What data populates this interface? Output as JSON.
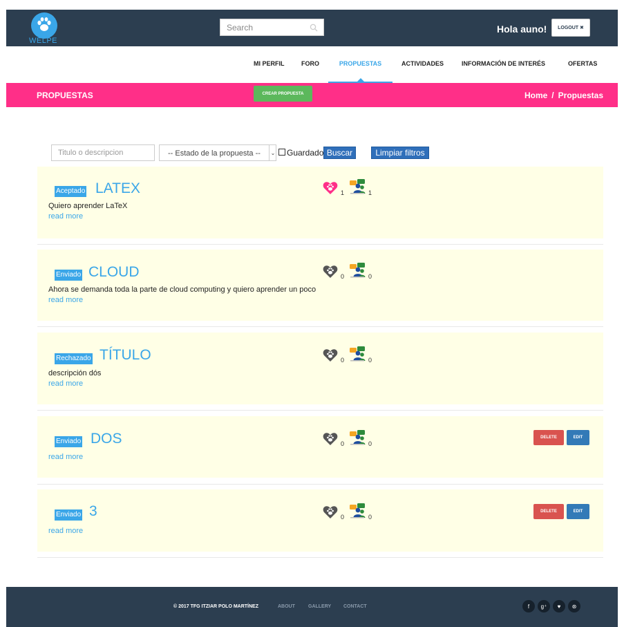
{
  "header": {
    "logo_text": "WELPE",
    "search_placeholder": "Search",
    "greeting": "Hola auno!",
    "logout_label": "LOGOUT ✖"
  },
  "nav": {
    "items": [
      "MI PERFIL",
      "FORO",
      "PROPUESTAS",
      "ACTIVIDADES",
      "INFORMACIÓN DE INTERÉS",
      "OFERTAS"
    ],
    "active": "PROPUESTAS"
  },
  "section": {
    "title": "PROPUESTAS",
    "create_label": "CREAR PROPUESTA",
    "breadcrumb": [
      "Home",
      "/",
      "Propuestas"
    ]
  },
  "filters": {
    "text_placeholder": "Titulo o descripcion",
    "state_selected": "-- Estado de la propuesta --",
    "saved_label": "Guardado",
    "search_label": "Buscar",
    "clear_label": "Limpiar filtros"
  },
  "proposals": [
    {
      "status": "Aceptado",
      "title": "LATEX",
      "description": "Quiero aprender LaTeX",
      "read_more": "read more",
      "likes": "1",
      "participants": "1",
      "liked": true,
      "owned": false
    },
    {
      "status": "Enviado",
      "title": "CLOUD",
      "description": "Ahora se demanda toda la parte de cloud computing y quiero aprender un poco",
      "read_more": "read more",
      "likes": "0",
      "participants": "0",
      "liked": false,
      "owned": false
    },
    {
      "status": "Rechazado",
      "title": "TÍTULO",
      "description": "descripción dós",
      "read_more": "read more",
      "likes": "0",
      "participants": "0",
      "liked": false,
      "owned": false
    },
    {
      "status": "Enviado",
      "title": "DOS",
      "description": "",
      "read_more": "read more",
      "likes": "0",
      "participants": "0",
      "liked": false,
      "owned": true,
      "delete_label": "DELETE",
      "edit_label": "EDIT"
    },
    {
      "status": "Enviado",
      "title": "3",
      "description": "",
      "read_more": "read more",
      "likes": "0",
      "participants": "0",
      "liked": false,
      "owned": true,
      "delete_label": "DELETE",
      "edit_label": "EDIT"
    }
  ],
  "footer": {
    "copyright": "© 2017 TFG ITZIAR POLO MARTÍNEZ",
    "links": [
      "ABOUT",
      "GALLERY",
      "CONTACT"
    ],
    "social": [
      {
        "icon": "facebook-icon",
        "glyph": "f"
      },
      {
        "icon": "google-plus-icon",
        "glyph": "g⁺"
      },
      {
        "icon": "twitter-icon",
        "glyph": "♥"
      },
      {
        "icon": "dribbble-icon",
        "glyph": "⊛"
      }
    ]
  },
  "colors": {
    "topbar": "#2c3e50",
    "accent": "#3aa6e8",
    "pink": "#ff2f88",
    "card_bg": "#ffffe6",
    "liked_heart": "#ff2f88",
    "unliked_heart": "#555555"
  }
}
